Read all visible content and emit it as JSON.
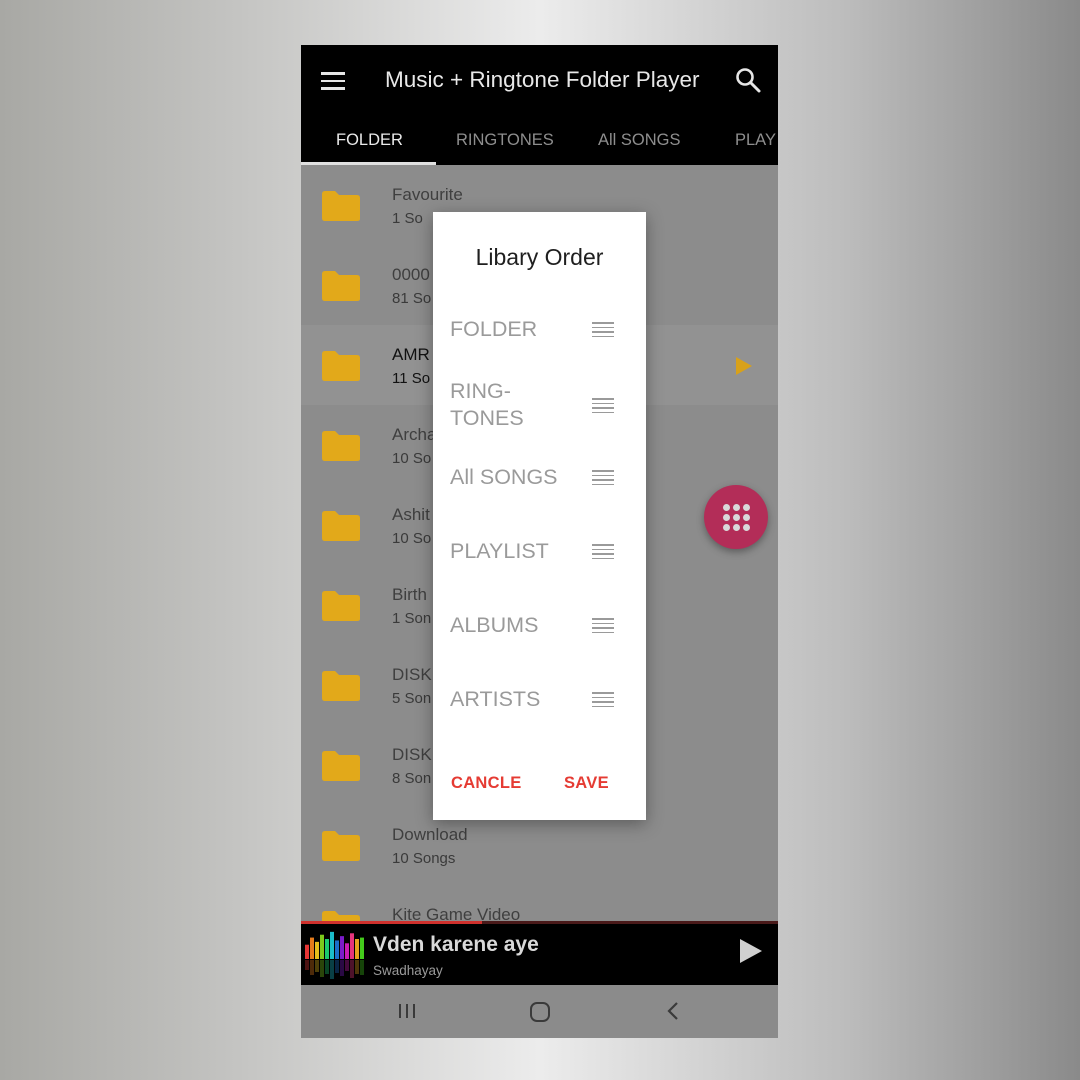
{
  "app": {
    "title": "Music + Ringtone Folder Player"
  },
  "tabs": [
    {
      "label": "FOLDER",
      "active": true
    },
    {
      "label": "RINGTONES",
      "active": false
    },
    {
      "label": "All SONGS",
      "active": false
    },
    {
      "label": "PLAY",
      "active": false
    }
  ],
  "folders": [
    {
      "name": "Favourite",
      "count": "1   So"
    },
    {
      "name": "0000",
      "count": "81 So"
    },
    {
      "name": "AMR",
      "count": "11 So",
      "playing": true
    },
    {
      "name": "Archa",
      "count": "10 So"
    },
    {
      "name": "Ashit",
      "count": "10 So"
    },
    {
      "name": "Birth",
      "count": "1 Son"
    },
    {
      "name": "DISK",
      "count": "5 Son"
    },
    {
      "name": "DISK",
      "count": "8 Son"
    },
    {
      "name": "Download",
      "count": "10 Songs"
    },
    {
      "name": "Kite Game Video",
      "count": ""
    }
  ],
  "now_playing": {
    "title": "Vden karene aye",
    "artist": "Swadhayay",
    "progress": 0.38
  },
  "dialog": {
    "title": "Libary Order",
    "items": [
      "FOLDER",
      "RING-\nTONES",
      "All SONGS",
      "PLAYLIST",
      "ALBUMS",
      "ARTISTS"
    ],
    "cancel_label": "CANCLE",
    "save_label": "SAVE"
  },
  "colors": {
    "accent_red": "#e53b33",
    "fab_pink": "#b32d58",
    "folder_yellow": "#e2a91a",
    "play_yellow": "#d8a11a"
  },
  "icons": {
    "menu": "hamburger-icon",
    "search": "search-icon",
    "folder": "folder-icon",
    "play": "play-icon",
    "fab": "dialpad-icon",
    "drag": "drag-handle-icon",
    "nav_recents": "recents-icon",
    "nav_home": "home-icon",
    "nav_back": "back-icon"
  }
}
